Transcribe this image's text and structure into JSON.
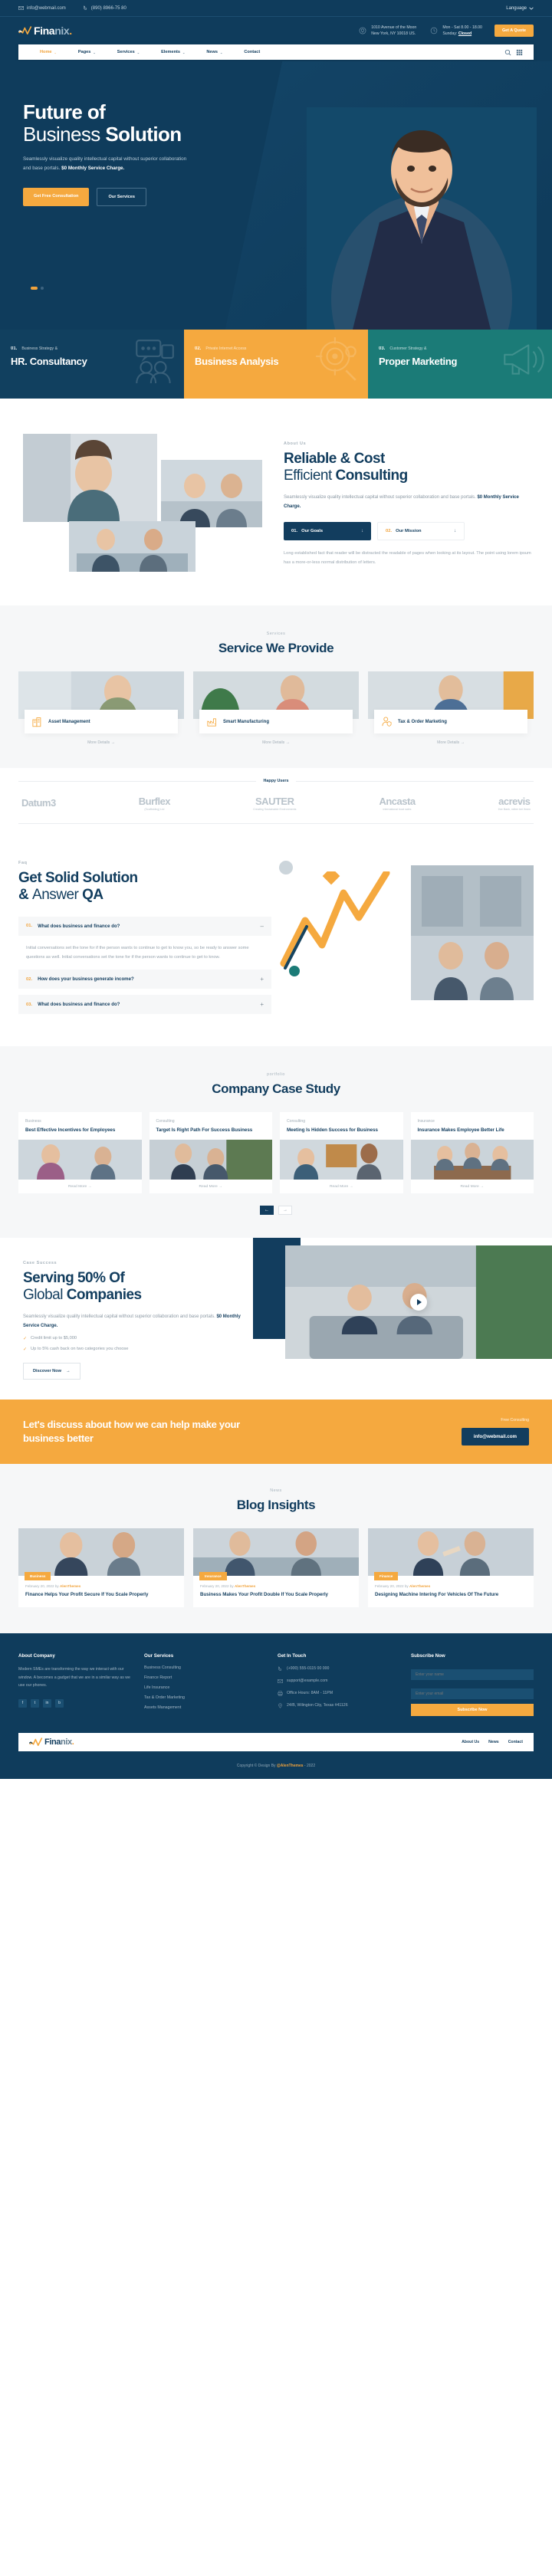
{
  "brand": {
    "name_part1": "Fina",
    "name_part2": "nix",
    "dot": ".",
    "accent_color": "#f5a93f",
    "navy_color": "#0f3c5c",
    "teal_color": "#1b7b77"
  },
  "topbar": {
    "email": "info@webmail.com",
    "phone": "(890) 8966-75 80",
    "language": "Language",
    "email_icon": "envelope-icon",
    "phone_icon": "phone-icon",
    "caret_icon": "chevron-down-icon"
  },
  "header": {
    "address_line1": "1010 Avenue of the Moon",
    "address_line2": "New York, NY 10018 US.",
    "hours_line1": "Mon - Sat 8.00 - 18.00",
    "hours_label": "Sunday:",
    "hours_value": "Closed",
    "quote_button": "Get A Quote",
    "location_icon": "map-pin-icon",
    "clock_icon": "clock-icon"
  },
  "nav": {
    "items": [
      {
        "label": "Home",
        "caret": "⌄",
        "active": true
      },
      {
        "label": "Pages",
        "caret": "⌄",
        "active": false
      },
      {
        "label": "Services",
        "caret": "⌄",
        "active": false
      },
      {
        "label": "Elements",
        "caret": "⌄",
        "active": false
      },
      {
        "label": "News",
        "caret": "⌄",
        "active": false
      },
      {
        "label": "Contact",
        "caret": "",
        "active": false
      }
    ],
    "search_icon": "search-icon",
    "grid_icon": "grid-menu-icon"
  },
  "hero": {
    "title_line1": "Future of",
    "title_thin": "Business",
    "title_line2_rest": "Solution",
    "paragraph_plain": "Seamlessly visualize quality intellectual capital without superior collaboration and base portals. ",
    "paragraph_bold": "$0 Monthly Service Charge.",
    "btn_primary": "Get Free Consultation",
    "btn_ghost": "Our Services"
  },
  "strips": [
    {
      "num": "01.",
      "category": "Business Strategy &",
      "title": "HR. Consultancy",
      "icon": "chat-group-icon"
    },
    {
      "num": "02.",
      "category": "Private Internet Access",
      "title": "Business Analysis",
      "icon": "target-search-icon"
    },
    {
      "num": "03.",
      "category": "Customer Strategy &",
      "title": "Proper Marketing",
      "icon": "megaphone-icon"
    }
  ],
  "about": {
    "eyebrow": "About Us",
    "title_line1": "Reliable & Cost",
    "title_thin": "Efficient",
    "title_rest": "Consulting",
    "paragraph_plain": "Seamlessly visualize quality intellectual capital without superior collaboration and base portals. ",
    "paragraph_bold": "$0 Monthly Service Charge.",
    "tabs": [
      {
        "num": "01.",
        "label": "Our Goals",
        "arrow": "↓",
        "active": true
      },
      {
        "num": "02.",
        "label": "Our Mission",
        "arrow": "↓",
        "active": false
      }
    ],
    "note": "Long established fact that reader will be distracted the readable of pages when looking at its layout. The point using lorem ipsum has a more-or-less normal distribution of letters."
  },
  "services": {
    "tag": "Services",
    "title": "Service We Provide",
    "cards": [
      {
        "name": "Asset Management",
        "icon": "building-chart-icon",
        "more": "More Details",
        "arrow": "→"
      },
      {
        "name": "Smart Manufacturing",
        "icon": "factory-icon",
        "more": "More Details",
        "arrow": "→"
      },
      {
        "name": "Tax & Order Marketing",
        "icon": "user-shield-icon",
        "more": "More Details",
        "arrow": "→"
      }
    ]
  },
  "brands": {
    "label": "Happy Users",
    "items": [
      {
        "name": "Datum3",
        "sub": ""
      },
      {
        "name": "Burflex",
        "sub": "(Scaffolding) Ltd"
      },
      {
        "name": "SAUTER",
        "sub": "Creating Sustainable Environments"
      },
      {
        "name": "Ancasta",
        "sub": "international boat sales"
      },
      {
        "name": "acrevis",
        "sub": "Ihre Bank, näher bei Ihnen"
      }
    ]
  },
  "faq": {
    "eyebrow": "Faq",
    "title_line1": "Get Solid Solution",
    "title_amp": "&",
    "title_thin": "Answer",
    "title_rest": "QA",
    "items": [
      {
        "num": "01.",
        "question": "What does business and finance do?",
        "sign": "–",
        "open": true,
        "answer": "Initial conversations set the tone for if the person wants to continue to get to know you, so be ready to answer some questions as well. Initial conversations set the tone for if the person wants to continue to get to know."
      },
      {
        "num": "02.",
        "question": "How does your business generate income?",
        "sign": "+",
        "open": false,
        "answer": ""
      },
      {
        "num": "03.",
        "question": "What does business and finance do?",
        "sign": "+",
        "open": false,
        "answer": ""
      }
    ]
  },
  "cases": {
    "tag": "portfolio",
    "title": "Company Case Study",
    "cards": [
      {
        "category": "Business",
        "title": "Best Effective Incentives for Employees",
        "link": "Read More",
        "arrow": "→"
      },
      {
        "category": "Consulting",
        "title": "Target Is Right Path For Success Business",
        "link": "Read More",
        "arrow": "→"
      },
      {
        "category": "Consulting",
        "title": "Meeting Is Hidden Success for Business",
        "link": "Read More",
        "arrow": "→"
      },
      {
        "category": "Insurance",
        "title": "Insurance Makes Employee Better Life",
        "link": "Read More",
        "arrow": "→"
      }
    ],
    "prev": "←",
    "next": "→"
  },
  "serving": {
    "eyebrow": "Case Success",
    "title_line1": "Serving 50% Of",
    "title_thin": "Global",
    "title_rest": "Companies",
    "paragraph_plain": "Seamlessly visualize quality intellectual capital without superior collaboration and base portals. ",
    "paragraph_bold": "$0 Monthly Service Charge.",
    "checks": [
      "Credit limit up to $5,000",
      "Up to 5% cash back on two categories you choose"
    ],
    "check_icon": "check-icon",
    "discover_label": "Discover Now",
    "discover_arrow": "→",
    "play_icon": "play-icon"
  },
  "cta": {
    "heading": "Let's discuss about how we can help make your business better",
    "label": "Free Consulting",
    "button": "info@webmail.com"
  },
  "blog": {
    "tag": "News",
    "title": "Blog Insights",
    "cards": [
      {
        "badge": "Business",
        "date": "February 20, 2022",
        "by": "by",
        "author": "AlenThemes",
        "title": "Finance Helps Your Profit Secure If You Scale Properly"
      },
      {
        "badge": "Insurance",
        "date": "February 20, 2022",
        "by": "by",
        "author": "AlenThemes",
        "title": "Business Makes Your Profit Double If You Scale Properly"
      },
      {
        "badge": "Finance",
        "date": "February 20, 2022",
        "by": "by",
        "author": "AlenThemes",
        "title": "Designing Machine Intering For Vehicles Of The Future"
      }
    ]
  },
  "footer": {
    "about_heading": "About Company",
    "about_text": "Modern SMEs are transforming the way we interact with our window. A becomes a gadget that we are in a similar way as we use our phones.",
    "socials": [
      "f",
      "t",
      "in",
      "b"
    ],
    "services_heading": "Our Services",
    "services": [
      "Business Consulting",
      "Finance Report",
      "Life Insurance",
      "Tax & Order Marketing",
      "Assets Management"
    ],
    "contact_heading": "Get In Touch",
    "contacts": [
      {
        "icon": "phone-icon",
        "text": "(+900) 555-0115 00 000"
      },
      {
        "icon": "envelope-icon",
        "text": "support@example.com"
      },
      {
        "icon": "printer-icon",
        "text": "Office Hours: 8AM - 11PM"
      },
      {
        "icon": "map-pin-icon",
        "text": "24/B, Wilington City, Texas\n#41126"
      }
    ],
    "subscribe_heading": "Subscribe Now",
    "name_placeholder": "Enter your name",
    "email_placeholder": "Enter your email",
    "subscribe_button": "Subscribe Now",
    "bar_links": [
      "About Us",
      "News",
      "Contact"
    ],
    "copyright_pre": "Copyright © Design By ",
    "copyright_brand": "@AlenThemes",
    "copyright_post": " - 2022"
  }
}
